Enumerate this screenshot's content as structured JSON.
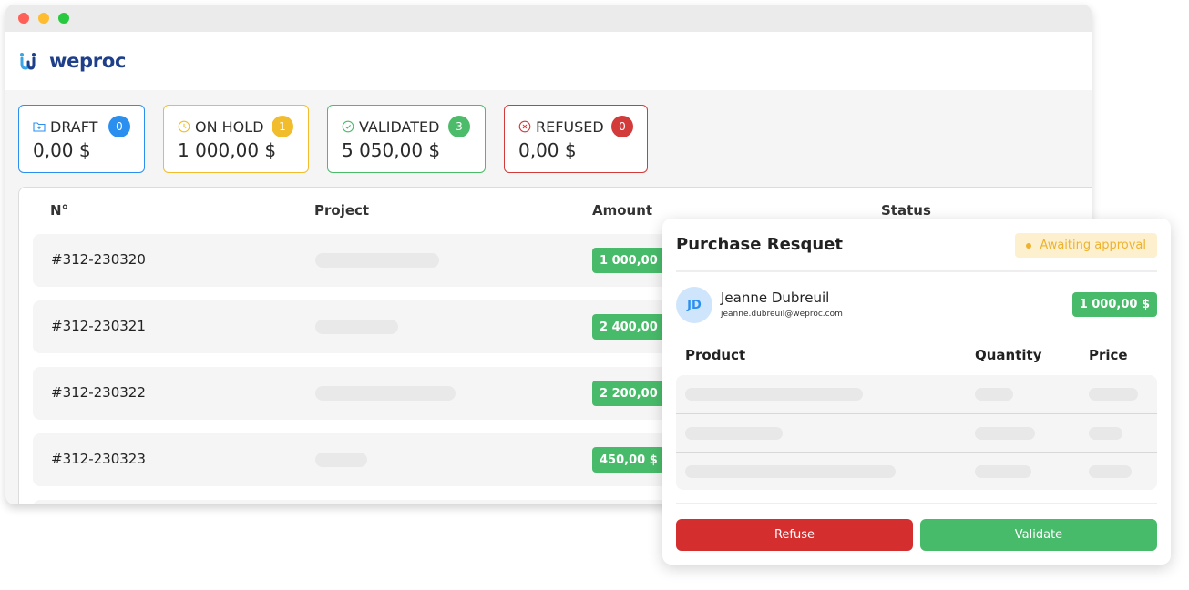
{
  "window": {
    "traffic_lights": [
      "close",
      "minimize",
      "maximize"
    ]
  },
  "brand": {
    "logo_icon": "weproc-logo-icon",
    "name": "weproc"
  },
  "status_cards": [
    {
      "key": "draft",
      "label": "DRAFT",
      "icon": "folder-plus-icon",
      "count": "0",
      "value": "0,00 $",
      "color": "#2b8ff0"
    },
    {
      "key": "on_hold",
      "label": "ON HOLD",
      "icon": "clock-icon",
      "count": "1",
      "value": "1 000,00 $",
      "color": "#f2bd2c"
    },
    {
      "key": "validated",
      "label": "VALIDATED",
      "icon": "check-circle-icon",
      "count": "3",
      "value": "5 050,00 $",
      "color": "#4cbb6a"
    },
    {
      "key": "refused",
      "label": "REFUSED",
      "icon": "x-circle-icon",
      "count": "0",
      "value": "0,00 $",
      "color": "#d33a3a"
    }
  ],
  "table": {
    "headers": {
      "number": "N°",
      "project": "Project",
      "amount": "Amount",
      "status": "Status"
    },
    "rows": [
      {
        "number": "#312-230320",
        "amount": "1 000,00 $"
      },
      {
        "number": "#312-230321",
        "amount": "2 400,00 $"
      },
      {
        "number": "#312-230322",
        "amount": "2 200,00 $"
      },
      {
        "number": "#312-230323",
        "amount": "450,00 $"
      }
    ]
  },
  "modal": {
    "title": "Purchase Resquet",
    "status": "Awaiting approval",
    "requester": {
      "initials": "JD",
      "name": "Jeanne Dubreuil",
      "email": "jeanne.dubreuil@weproc.com"
    },
    "amount": "1 000,00 $",
    "headers": {
      "product": "Product",
      "quantity": "Quantity",
      "price": "Price"
    },
    "refuse_label": "Refuse",
    "validate_label": "Validate"
  },
  "colors": {
    "accent_green": "#48bb6a",
    "accent_red": "#d42e2f",
    "pending_yellow": "#eeb22d",
    "brand_blue": "#1f3f8a"
  }
}
